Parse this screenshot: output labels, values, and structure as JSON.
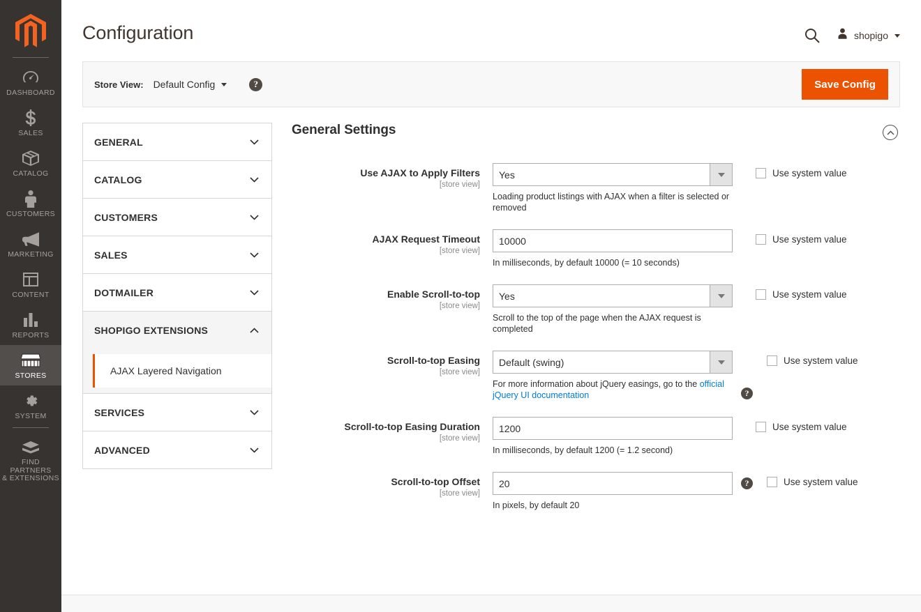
{
  "sidebar": {
    "logo_name": "magento-logo",
    "items": [
      {
        "label": "DASHBOARD",
        "icon": "dashboard-icon",
        "active": false
      },
      {
        "label": "SALES",
        "icon": "dollar-icon",
        "active": false
      },
      {
        "label": "CATALOG",
        "icon": "box-icon",
        "active": false
      },
      {
        "label": "CUSTOMERS",
        "icon": "person-icon",
        "active": false
      },
      {
        "label": "MARKETING",
        "icon": "megaphone-icon",
        "active": false
      },
      {
        "label": "CONTENT",
        "icon": "layout-icon",
        "active": false
      },
      {
        "label": "REPORTS",
        "icon": "bar-chart-icon",
        "active": false
      },
      {
        "label": "STORES",
        "icon": "storefront-icon",
        "active": true
      },
      {
        "label": "SYSTEM",
        "icon": "gear-icon",
        "active": false
      },
      {
        "label": "FIND PARTNERS\n& EXTENSIONS",
        "label_line1": "FIND PARTNERS",
        "label_line2": "& EXTENSIONS",
        "icon": "extension-block-icon",
        "active": false
      }
    ]
  },
  "header": {
    "title": "Configuration",
    "search_icon": "search-icon",
    "user_icon": "user-avatar-icon",
    "user_name": "shopigo"
  },
  "switcher": {
    "label": "Store View:",
    "value": "Default Config",
    "help_icon": "question-mark-icon",
    "save_label": "Save Config",
    "accent": "#eb5202"
  },
  "config_nav": {
    "groups": [
      {
        "label": "GENERAL",
        "open": false
      },
      {
        "label": "CATALOG",
        "open": false
      },
      {
        "label": "CUSTOMERS",
        "open": false
      },
      {
        "label": "SALES",
        "open": false
      },
      {
        "label": "DOTMAILER",
        "open": false
      },
      {
        "label": "SHOPIGO EXTENSIONS",
        "open": true,
        "children": [
          {
            "label": "AJAX Layered Navigation",
            "active": true
          }
        ]
      },
      {
        "label": "SERVICES",
        "open": false
      },
      {
        "label": "ADVANCED",
        "open": false
      }
    ]
  },
  "section": {
    "title": "General Settings",
    "collapse_icon": "chevron-up-circle-icon",
    "scope_note": "[store view]",
    "system_value_label": "Use system value",
    "fields": [
      {
        "label": "Use AJAX to Apply Filters",
        "scope": "[store view]",
        "type": "select",
        "value": "Yes",
        "note": "Loading product listings with AJAX when a filter is selected or removed",
        "has_help": false,
        "system_value_label": "Use system value",
        "system_value_checked": false
      },
      {
        "label": "AJAX Request Timeout",
        "scope": "[store view]",
        "type": "text",
        "value": "10000",
        "note": "In milliseconds, by default 10000 (= 10 seconds)",
        "has_help": false,
        "system_value_label": "Use system value",
        "system_value_checked": false
      },
      {
        "label": "Enable Scroll-to-top",
        "scope": "[store view]",
        "type": "select",
        "value": "Yes",
        "note": "Scroll to the top of the page when the AJAX request is completed",
        "has_help": false,
        "system_value_label": "Use system value",
        "system_value_checked": false
      },
      {
        "label": "Scroll-to-top Easing",
        "scope": "[store view]",
        "type": "select",
        "value": "Default (swing)",
        "note_prefix": "For more information about jQuery easings, go to the ",
        "note_link": "official jQuery UI documentation",
        "has_help": true,
        "help_icon": "question-mark-icon",
        "link_color": "#007bdb",
        "system_value_label": "Use system value",
        "system_value_checked": false
      },
      {
        "label": "Scroll-to-top Easing Duration",
        "scope": "[store view]",
        "type": "text",
        "value": "1200",
        "note": "In milliseconds, by default 1200 (= 1.2 second)",
        "has_help": false,
        "system_value_label": "Use system value",
        "system_value_checked": false
      },
      {
        "label": "Scroll-to-top Offset",
        "scope": "[store view]",
        "type": "text",
        "value": "20",
        "note": "In pixels, by default 20",
        "has_help": true,
        "help_icon": "question-mark-icon",
        "system_value_label": "Use system value",
        "system_value_checked": false
      }
    ]
  }
}
